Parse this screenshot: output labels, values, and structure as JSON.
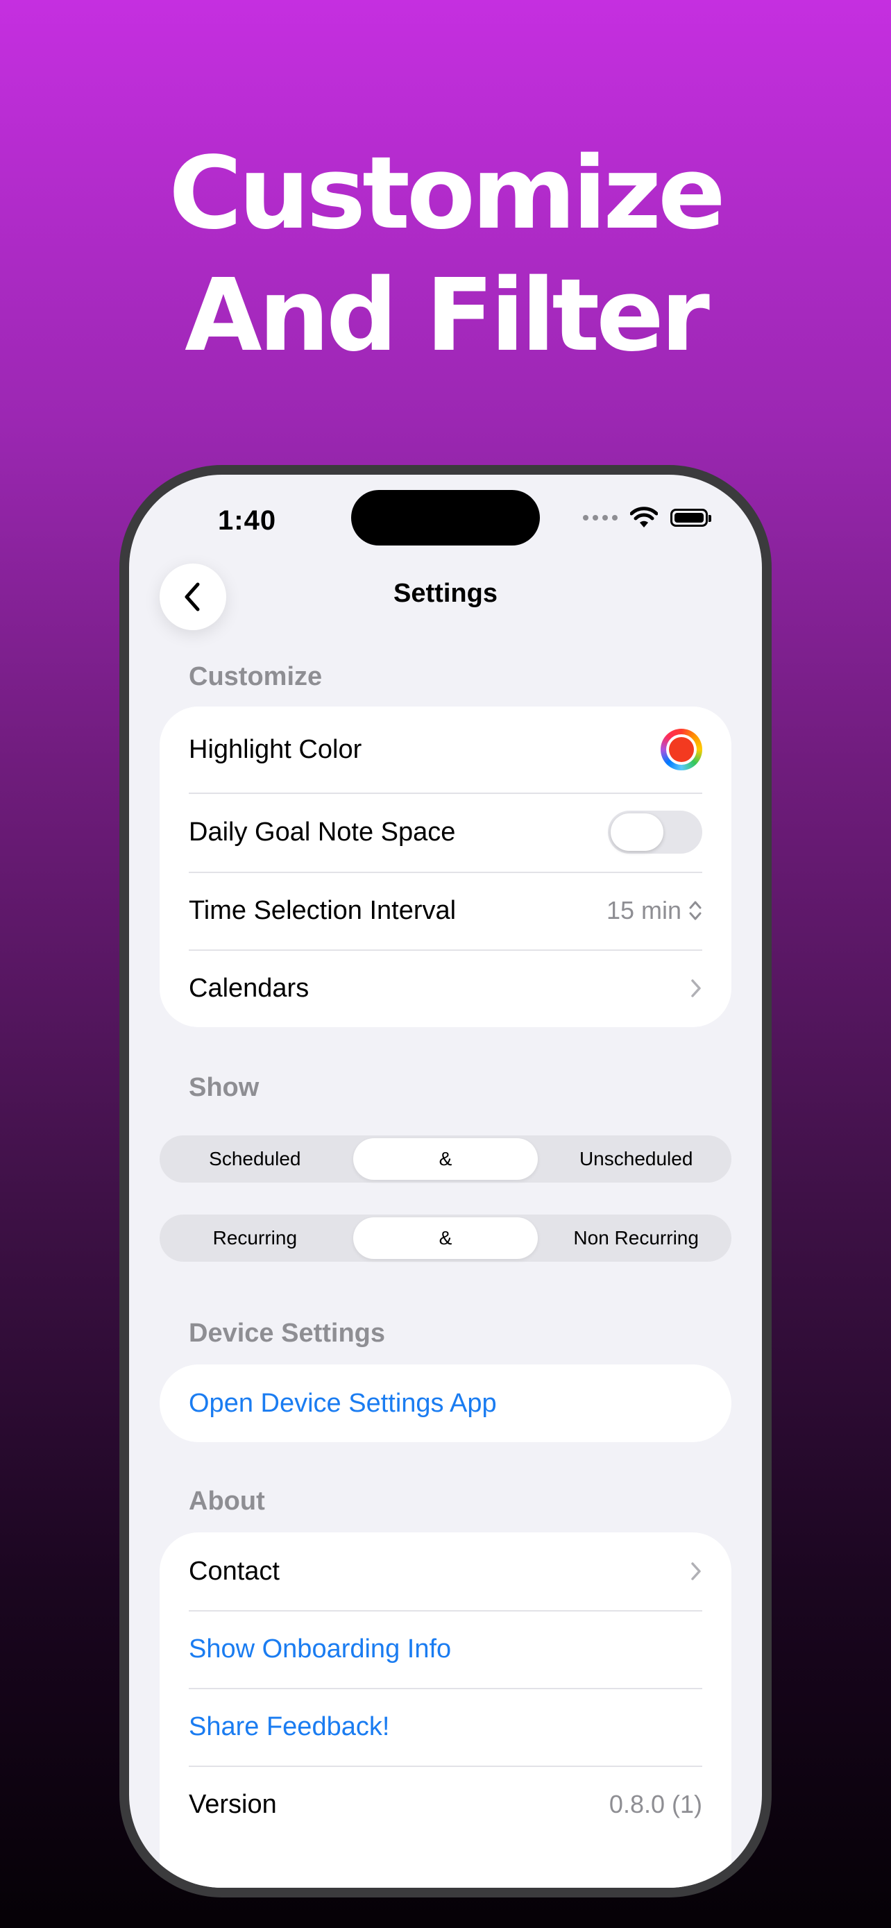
{
  "headline": {
    "line1": "Customize",
    "line2": "And Filter"
  },
  "status_bar": {
    "time": "1:40"
  },
  "nav": {
    "title": "Settings"
  },
  "customize": {
    "header": "Customize",
    "highlight_color": {
      "label": "Highlight Color",
      "color": "#f33a20"
    },
    "daily_goal": {
      "label": "Daily Goal Note Space",
      "enabled": false
    },
    "time_interval": {
      "label": "Time Selection Interval",
      "value": "15 min"
    },
    "calendars": {
      "label": "Calendars"
    }
  },
  "show": {
    "header": "Show",
    "segment1": [
      "Scheduled",
      "&",
      "Unscheduled"
    ],
    "segment2": [
      "Recurring",
      "&",
      "Non Recurring"
    ]
  },
  "device_settings": {
    "header": "Device Settings",
    "open_label": "Open Device Settings App"
  },
  "about": {
    "header": "About",
    "contact": "Contact",
    "onboarding": "Show Onboarding Info",
    "feedback": "Share Feedback!",
    "version_label": "Version",
    "version_value": "0.8.0 (1)"
  },
  "colors": {
    "link": "#1a7cf1",
    "background": "#f2f2f7",
    "secondary_text": "#8e8e93"
  }
}
